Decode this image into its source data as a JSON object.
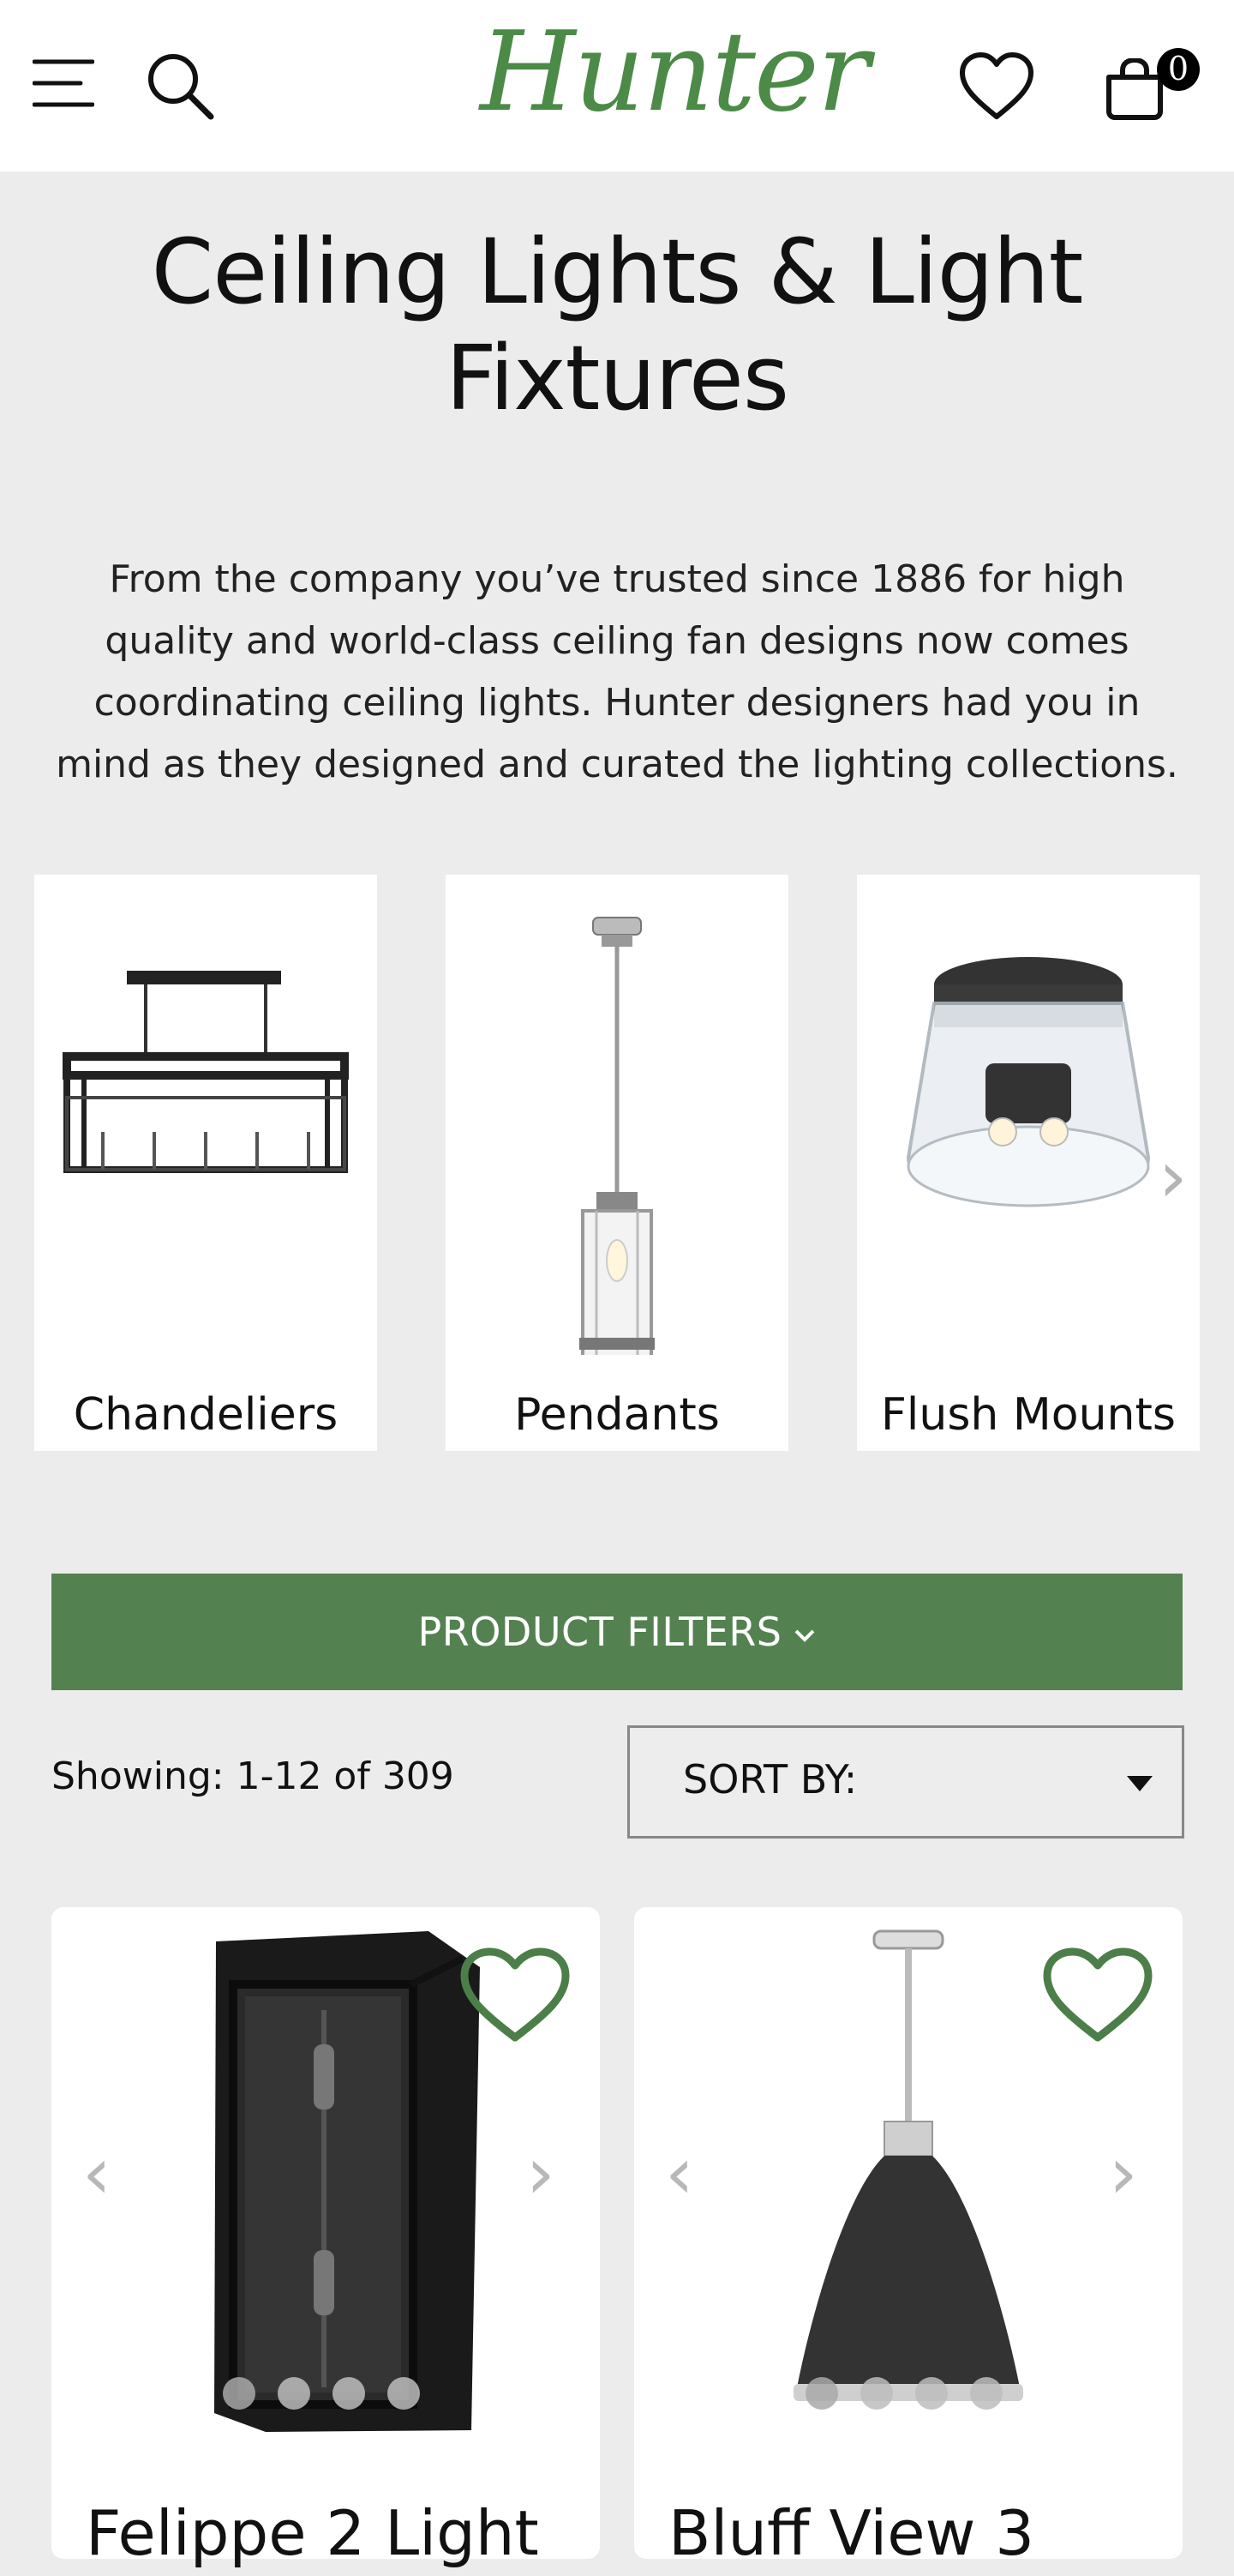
{
  "header": {
    "logo_text": "Hunter",
    "cart_count": "0",
    "icons": [
      "menu-icon",
      "search-icon",
      "heart-icon",
      "cart-icon"
    ]
  },
  "page": {
    "title": "Ceiling Lights & Light Fixtures",
    "intro": "From the company you’ve trusted since 1886 for high quality and world-class ceiling fan designs now comes coordinating ceiling lights. Hunter designers had you in mind as they designed and curated the lighting collections."
  },
  "categories": [
    {
      "label": "Chandeliers"
    },
    {
      "label": "Pendants"
    },
    {
      "label": "Flush Mounts"
    }
  ],
  "carousel": {
    "prev": "‹",
    "next": "›"
  },
  "filters": {
    "button_label": "PRODUCT FILTERS",
    "showing": "Showing: 1-12 of 309",
    "sort_label": "SORT BY:"
  },
  "products": [
    {
      "name": "Felippe 2 Light",
      "image_count": 4
    },
    {
      "name": "Bluff View 3",
      "image_count": 4
    }
  ],
  "colors": {
    "brand_green": "#538250",
    "logo_green": "#4c8a47",
    "page_bg": "#ececec"
  }
}
